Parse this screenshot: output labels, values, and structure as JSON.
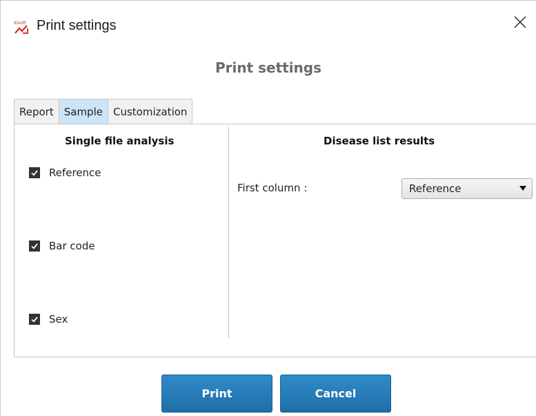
{
  "window": {
    "title": "Print settings",
    "icon": "app-logo-icon",
    "close_icon": "close-icon"
  },
  "dialog": {
    "heading": "Print settings"
  },
  "tabs": [
    {
      "label": "Report",
      "active": false
    },
    {
      "label": "Sample",
      "active": true
    },
    {
      "label": "Customization",
      "active": false
    }
  ],
  "left_section": {
    "title": "Single file analysis",
    "checkboxes": [
      {
        "label": "Reference",
        "checked": true
      },
      {
        "label": "Bar code",
        "checked": true
      },
      {
        "label": "Sex",
        "checked": true
      }
    ]
  },
  "right_section": {
    "title": "Disease list results",
    "first_column_label": "First column :",
    "first_column_value": "Reference"
  },
  "buttons": {
    "print": "Print",
    "cancel": "Cancel"
  },
  "colors": {
    "active_tab": "#cce4f7",
    "primary_button": "#2a7fbd",
    "heading_gray": "#6a6a6a"
  }
}
